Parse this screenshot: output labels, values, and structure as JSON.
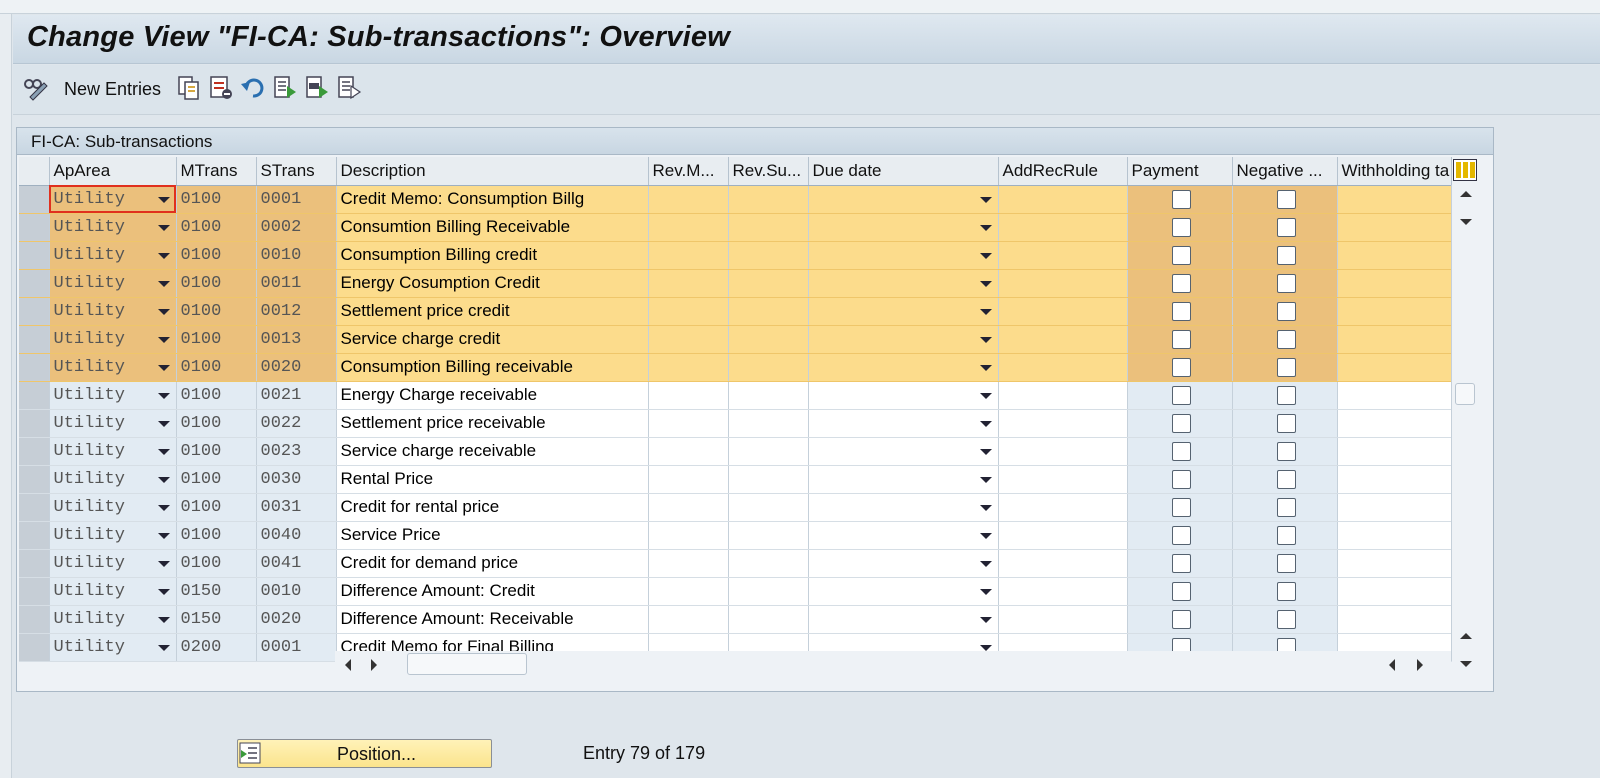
{
  "window": {
    "title": "Change View \"FI-CA: Sub-transactions\": Overview"
  },
  "toolbar": {
    "new_entries_label": "New Entries",
    "icons": [
      "display-change-icon",
      "copy-as-icon",
      "delete-icon",
      "undo-icon",
      "select-all-icon",
      "select-block-icon",
      "deselect-all-icon"
    ]
  },
  "table": {
    "title": "FI-CA: Sub-transactions",
    "columns": [
      "ApArea",
      "MTrans",
      "STrans",
      "Description",
      "Rev.M...",
      "Rev.Su...",
      "Due date",
      "AddRecRule",
      "Payment",
      "Negative ...",
      "Withholding ta"
    ],
    "rows": [
      {
        "aparea": "Utility",
        "mtrans": "0100",
        "strans": "0001",
        "description": "Credit Memo: Consumption Billg",
        "selected": true
      },
      {
        "aparea": "Utility",
        "mtrans": "0100",
        "strans": "0002",
        "description": "Consumtion Billing Receivable",
        "selected": true
      },
      {
        "aparea": "Utility",
        "mtrans": "0100",
        "strans": "0010",
        "description": "Consumption Billing credit",
        "selected": true
      },
      {
        "aparea": "Utility",
        "mtrans": "0100",
        "strans": "0011",
        "description": "Energy Cosumption Credit",
        "selected": true
      },
      {
        "aparea": "Utility",
        "mtrans": "0100",
        "strans": "0012",
        "description": "Settlement price credit",
        "selected": true
      },
      {
        "aparea": "Utility",
        "mtrans": "0100",
        "strans": "0013",
        "description": "Service charge credit",
        "selected": true
      },
      {
        "aparea": "Utility",
        "mtrans": "0100",
        "strans": "0020",
        "description": "Consumption Billing receivable",
        "selected": true
      },
      {
        "aparea": "Utility",
        "mtrans": "0100",
        "strans": "0021",
        "description": "Energy Charge receivable",
        "selected": false
      },
      {
        "aparea": "Utility",
        "mtrans": "0100",
        "strans": "0022",
        "description": "Settlement price receivable",
        "selected": false
      },
      {
        "aparea": "Utility",
        "mtrans": "0100",
        "strans": "0023",
        "description": "Service charge receivable",
        "selected": false
      },
      {
        "aparea": "Utility",
        "mtrans": "0100",
        "strans": "0030",
        "description": "Rental Price",
        "selected": false
      },
      {
        "aparea": "Utility",
        "mtrans": "0100",
        "strans": "0031",
        "description": "Credit for rental price",
        "selected": false
      },
      {
        "aparea": "Utility",
        "mtrans": "0100",
        "strans": "0040",
        "description": "Service Price",
        "selected": false
      },
      {
        "aparea": "Utility",
        "mtrans": "0100",
        "strans": "0041",
        "description": "Credit for demand price",
        "selected": false
      },
      {
        "aparea": "Utility",
        "mtrans": "0150",
        "strans": "0010",
        "description": "Difference Amount: Credit",
        "selected": false
      },
      {
        "aparea": "Utility",
        "mtrans": "0150",
        "strans": "0020",
        "description": "Difference Amount: Receivable",
        "selected": false
      },
      {
        "aparea": "Utility",
        "mtrans": "0200",
        "strans": "0001",
        "description": "Credit Memo for Final Billing",
        "selected": false
      }
    ]
  },
  "footer": {
    "position_label": "Position...",
    "entry_text": "Entry 79 of 179"
  },
  "colors": {
    "selected_row": "#fcdc8c",
    "selected_key": "#ebc07c",
    "key_column": "#e2ebf3",
    "position_button": "#fbe48d"
  }
}
